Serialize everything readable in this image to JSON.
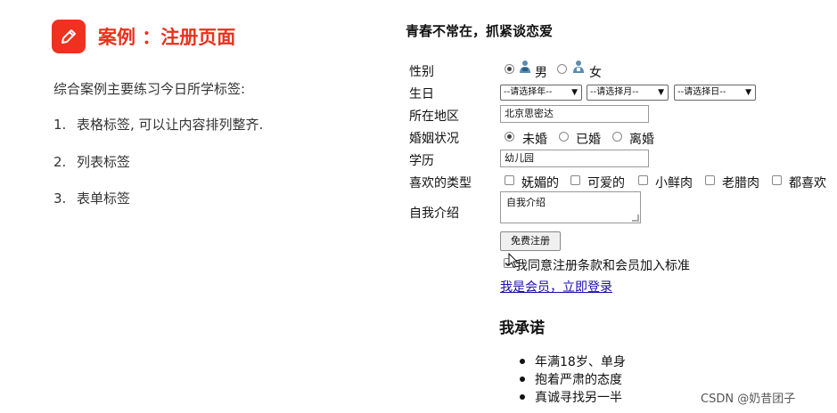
{
  "lesson": {
    "icon": "pencil-icon",
    "title": "案例 ：注册页面",
    "intro": "综合案例主要练习今日所学标签:",
    "items": [
      {
        "num": "1.",
        "text": "表格标签, 可以让内容排列整齐."
      },
      {
        "num": "2.",
        "text": "列表标签"
      },
      {
        "num": "3.",
        "text": "表单标签"
      }
    ]
  },
  "form": {
    "heading": "青春不常在，抓紧谈恋爱",
    "labels": {
      "gender": "性别",
      "birthday": "生日",
      "region": "所在地区",
      "marital": "婚姻状况",
      "education": "学历",
      "likes": "喜欢的类型",
      "intro": "自我介绍"
    },
    "gender_options": [
      {
        "label": "男",
        "icon": "male-user-icon",
        "checked": true
      },
      {
        "label": "女",
        "icon": "female-user-icon",
        "checked": false
      }
    ],
    "birthday_selects": [
      "--请选择年--",
      "--请选择月--",
      "--请选择日--"
    ],
    "region_value": "北京思密达",
    "marital_options": [
      {
        "label": "未婚",
        "checked": true
      },
      {
        "label": "已婚",
        "checked": false
      },
      {
        "label": "离婚",
        "checked": false
      }
    ],
    "education_value": "幼儿园",
    "likes_options": [
      "妩媚的",
      "可爱的",
      "小鲜肉",
      "老腊肉",
      "都喜欢"
    ],
    "intro_value": "自我介绍",
    "submit_label": "免费注册",
    "agree_text": "我同意注册条款和会员加入标准",
    "login_link": "我是会员，立即登录"
  },
  "promise": {
    "heading": "我承诺",
    "items": [
      "年满18岁、单身",
      "抱着严肃的态度",
      "真诚寻找另一半"
    ]
  },
  "watermark": "CSDN @奶昔团子"
}
